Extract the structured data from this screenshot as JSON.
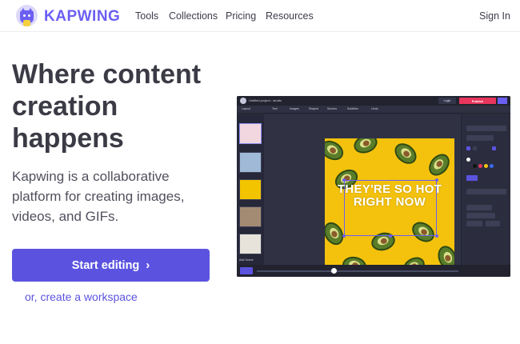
{
  "nav": {
    "brand": "KAPWING",
    "links": [
      "Tools",
      "Collections",
      "Pricing",
      "Resources"
    ],
    "sign_in": "Sign In"
  },
  "hero": {
    "title": "Where content creation happens",
    "subtitle": "Kapwing is a collaborative platform for creating images, videos, and GIFs.",
    "cta_label": "Start editing",
    "cta_icon": "chevron-right-icon",
    "secondary_link": "or, create a workspace"
  },
  "editor": {
    "project_name": "Untitled project - studio",
    "login_label": "Login",
    "publish_label": "Publish",
    "toolbar": [
      "Layout",
      "Text",
      "Images",
      "Shapes",
      "Scenes",
      "Subtitles",
      "Undo"
    ],
    "add_scene": "Add Scene",
    "canvas_text": "THEY'RE SO HOT RIGHT NOW",
    "colors": {
      "accent": "#5b53e0",
      "publish": "#e8365d",
      "canvas_bg": "#f4c20d"
    }
  }
}
